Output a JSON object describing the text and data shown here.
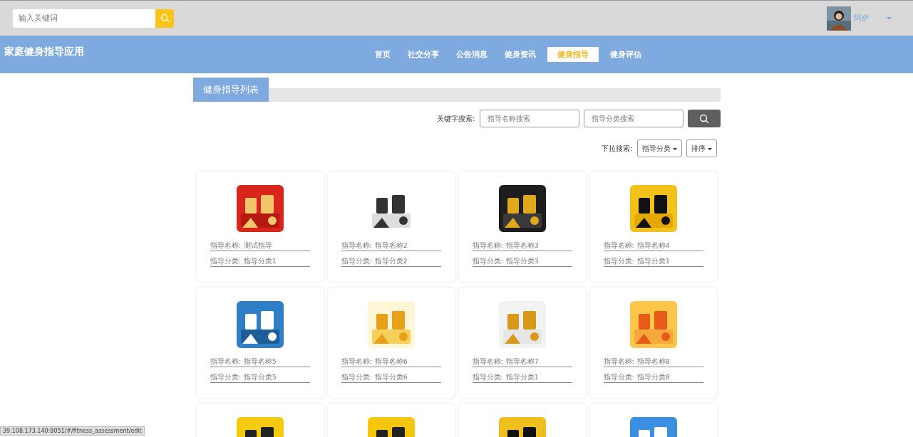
{
  "top_search": {
    "placeholder": "输入关键词"
  },
  "user": {
    "name": "阿萨"
  },
  "brand": "家庭健身指导应用",
  "nav": [
    {
      "label": "首页",
      "selected": false
    },
    {
      "label": "社交分享",
      "selected": false
    },
    {
      "label": "公告消息",
      "selected": false
    },
    {
      "label": "健身资讯",
      "selected": false
    },
    {
      "label": "健身指导",
      "selected": true
    },
    {
      "label": "健身评估",
      "selected": false
    }
  ],
  "section_title": "健身指导列表",
  "keyword_search": {
    "label": "关键字搜索:",
    "fields": [
      {
        "placeholder": "指导名称搜索"
      },
      {
        "placeholder": "指导分类搜索"
      }
    ]
  },
  "dropdown_search": {
    "label": "下拉搜索:",
    "dropdowns": [
      "指导分类",
      "排序"
    ]
  },
  "cards": [
    {
      "kind": "full",
      "name_label": "指导名称:",
      "name": "测试指导",
      "category_label": "指导分类:",
      "category": "指导分类1"
    },
    {
      "kind": "full",
      "name_label": "指导名称:",
      "name": "指导名称2",
      "category_label": "指导分类:",
      "category": "指导分类2"
    },
    {
      "kind": "full",
      "name_label": "指导名称:",
      "name": "指导名称3",
      "category_label": "指导分类:",
      "category": "指导分类3"
    },
    {
      "kind": "full",
      "name_label": "指导名称:",
      "name": "指导名称4",
      "category_label": "指导分类:",
      "category": "指导分类1"
    },
    {
      "kind": "full",
      "name_label": "指导名称:",
      "name": "指导名称5",
      "category_label": "指导分类:",
      "category": "指导分类5"
    },
    {
      "kind": "full",
      "name_label": "指导名称:",
      "name": "指导名称6",
      "category_label": "指导分类:",
      "category": "指导分类6"
    },
    {
      "kind": "full",
      "name_label": "指导名称:",
      "name": "指导名称7",
      "category_label": "指导分类:",
      "category": "指导分类1"
    },
    {
      "kind": "full",
      "name_label": "指导名称:",
      "name": "指导名称8",
      "category_label": "指导分类:",
      "category": "指导分类8"
    },
    {
      "kind": "partial"
    },
    {
      "kind": "partial"
    },
    {
      "kind": "partial"
    },
    {
      "kind": "partial"
    }
  ],
  "status_url": "39.108.173.140:8051/#/fitness_assessment/edit"
}
